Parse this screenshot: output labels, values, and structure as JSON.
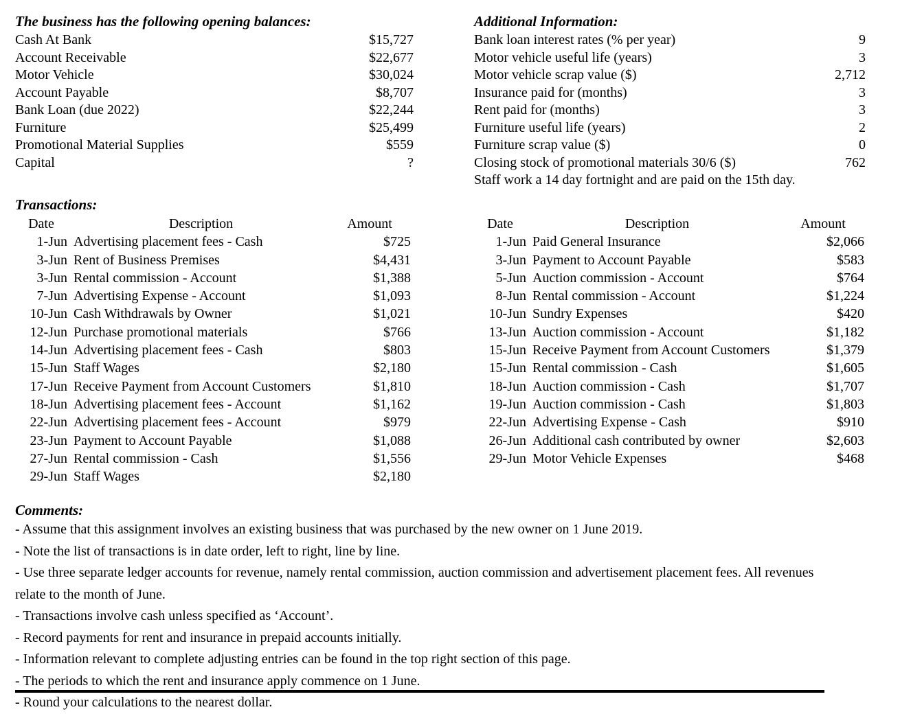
{
  "opening_balances": {
    "heading": "The business has the following opening balances:",
    "rows": [
      {
        "label": "Cash At Bank",
        "value": "$15,727"
      },
      {
        "label": "Account Receivable",
        "value": "$22,677"
      },
      {
        "label": "Motor Vehicle",
        "value": "$30,024"
      },
      {
        "label": "Account Payable",
        "value": "$8,707"
      },
      {
        "label": "Bank Loan (due 2022)",
        "value": "$22,244"
      },
      {
        "label": "Furniture",
        "value": "$25,499"
      },
      {
        "label": "Promotional Material Supplies",
        "value": "$559"
      },
      {
        "label": "Capital",
        "value": "?"
      }
    ]
  },
  "additional_information": {
    "heading": "Additional Information:",
    "rows": [
      {
        "label": "Bank loan interest rates (% per year)",
        "value": "9"
      },
      {
        "label": "Motor vehicle useful life (years)",
        "value": "3"
      },
      {
        "label": "Motor vehicle scrap value ($)",
        "value": "2,712"
      },
      {
        "label": "Insurance paid for (months)",
        "value": "3"
      },
      {
        "label": "Rent paid for (months)",
        "value": "3"
      },
      {
        "label": "Furniture useful life (years)",
        "value": "2"
      },
      {
        "label": "Furniture scrap value ($)",
        "value": "0"
      },
      {
        "label": "Closing stock of promotional materials 30/6 ($)",
        "value": "762"
      }
    ],
    "note": "Staff work a 14 day fortnight and are paid on the 15th day."
  },
  "transactions": {
    "heading": "Transactions:",
    "columns": {
      "date": "Date",
      "description": "Description",
      "amount": "Amount"
    },
    "left_rows": [
      {
        "date": "1-Jun",
        "description": "Advertising placement fees - Cash",
        "amount": "$725"
      },
      {
        "date": "3-Jun",
        "description": "Rent of Business Premises",
        "amount": "$4,431"
      },
      {
        "date": "3-Jun",
        "description": "Rental commission - Account",
        "amount": "$1,388"
      },
      {
        "date": "7-Jun",
        "description": "Advertising Expense - Account",
        "amount": "$1,093"
      },
      {
        "date": "10-Jun",
        "description": "Cash Withdrawals by Owner",
        "amount": "$1,021"
      },
      {
        "date": "12-Jun",
        "description": "Purchase promotional materials",
        "amount": "$766"
      },
      {
        "date": "14-Jun",
        "description": "Advertising placement fees - Cash",
        "amount": "$803"
      },
      {
        "date": "15-Jun",
        "description": "Staff Wages",
        "amount": "$2,180"
      },
      {
        "date": "17-Jun",
        "description": "Receive Payment from Account Customers",
        "amount": "$1,810"
      },
      {
        "date": "18-Jun",
        "description": "Advertising placement fees - Account",
        "amount": "$1,162"
      },
      {
        "date": "22-Jun",
        "description": "Advertising placement fees - Account",
        "amount": "$979"
      },
      {
        "date": "23-Jun",
        "description": "Payment to Account Payable",
        "amount": "$1,088"
      },
      {
        "date": "27-Jun",
        "description": "Rental commission - Cash",
        "amount": "$1,556"
      },
      {
        "date": "29-Jun",
        "description": "Staff Wages",
        "amount": "$2,180"
      }
    ],
    "right_rows": [
      {
        "date": "1-Jun",
        "description": "Paid General Insurance",
        "amount": "$2,066"
      },
      {
        "date": "3-Jun",
        "description": "Payment to Account Payable",
        "amount": "$583"
      },
      {
        "date": "5-Jun",
        "description": "Auction commission - Account",
        "amount": "$764"
      },
      {
        "date": "8-Jun",
        "description": "Rental commission - Account",
        "amount": "$1,224"
      },
      {
        "date": "10-Jun",
        "description": "Sundry Expenses",
        "amount": "$420"
      },
      {
        "date": "13-Jun",
        "description": "Auction commission - Account",
        "amount": "$1,182"
      },
      {
        "date": "15-Jun",
        "description": "Receive Payment from Account Customers",
        "amount": "$1,379"
      },
      {
        "date": "15-Jun",
        "description": "Rental commission - Cash",
        "amount": "$1,605"
      },
      {
        "date": "18-Jun",
        "description": "Auction commission - Cash",
        "amount": "$1,707"
      },
      {
        "date": "19-Jun",
        "description": "Auction commission - Cash",
        "amount": "$1,803"
      },
      {
        "date": "22-Jun",
        "description": "Advertising Expense - Cash",
        "amount": "$910"
      },
      {
        "date": "26-Jun",
        "description": "Additional cash contributed by owner",
        "amount": "$2,603"
      },
      {
        "date": "29-Jun",
        "description": "Motor Vehicle Expenses",
        "amount": "$468"
      }
    ]
  },
  "comments": {
    "heading": "Comments:",
    "lines": [
      "- Assume that this assignment involves an existing business that was purchased by the new owner on 1 June 2019.",
      "- Note the list of transactions is in date order, left to right, line by line.",
      "- Use three separate ledger accounts for revenue, namely rental commission, auction commission and advertisement placement fees. All revenues relate to the month of June.",
      "- Transactions involve cash unless specified as ‘Account’.",
      "- Record payments for rent and insurance in prepaid accounts initially.",
      "- Information relevant to complete adjusting entries can be found in the top right section of this page.",
      "- The periods to which the rent and insurance apply commence on 1 June.",
      "- Round your calculations to the nearest dollar."
    ]
  }
}
